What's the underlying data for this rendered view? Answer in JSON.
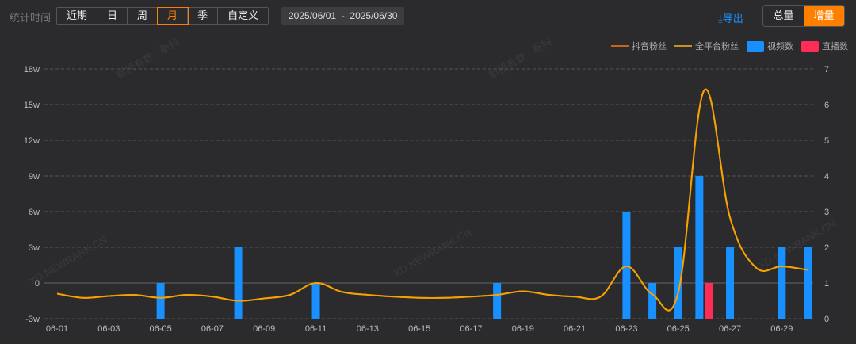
{
  "header": {
    "stat_label": "统计时间",
    "periods": [
      "近期",
      "日",
      "周",
      "月",
      "季",
      "自定义"
    ],
    "active_period": "月",
    "date_range": "2025/06/01  -  2025/06/30",
    "export_label": "导出",
    "toggle": [
      "总量",
      "增量"
    ],
    "active_toggle": "增量"
  },
  "watermarks": [
    "新榜有数 · 新抖",
    "新榜有数 · 新抖",
    "XD.NEWRANK.CN",
    "XD.NEWRANK.CN",
    "XD.NEWRANK.CN"
  ],
  "colors": {
    "douyin": "#c8641e",
    "all": "#f5a300",
    "video": "#1890ff",
    "live": "#ff2d55"
  },
  "chart_data": {
    "type": "bar+line",
    "categories": [
      "06-01",
      "06-02",
      "06-03",
      "06-04",
      "06-05",
      "06-06",
      "06-07",
      "06-08",
      "06-09",
      "06-10",
      "06-11",
      "06-12",
      "06-13",
      "06-14",
      "06-15",
      "06-16",
      "06-17",
      "06-18",
      "06-19",
      "06-20",
      "06-21",
      "06-22",
      "06-23",
      "06-24",
      "06-25",
      "06-26",
      "06-27",
      "06-28",
      "06-29",
      "06-30"
    ],
    "x_tick_labels": [
      "06-01",
      "06-03",
      "06-05",
      "06-07",
      "06-09",
      "06-11",
      "06-13",
      "06-15",
      "06-17",
      "06-19",
      "06-21",
      "06-23",
      "06-25",
      "06-27",
      "06-29"
    ],
    "left_axis": {
      "ticks": [
        "-3w",
        "0",
        "3w",
        "6w",
        "9w",
        "12w",
        "15w",
        "18w"
      ],
      "range": [
        -30000,
        180000
      ]
    },
    "right_axis": {
      "ticks": [
        "0",
        "1",
        "2",
        "3",
        "4",
        "5",
        "6",
        "7"
      ],
      "range": [
        0,
        7
      ]
    },
    "legend": [
      "抖音粉丝",
      "全平台粉丝",
      "视频数",
      "直播数"
    ],
    "series": [
      {
        "name": "抖音粉丝",
        "axis": "left",
        "type": "line",
        "values": [
          -9000,
          -12500,
          -11000,
          -10000,
          -12500,
          -10000,
          -11500,
          -15000,
          -13000,
          -10000,
          0,
          -7500,
          -10000,
          -11500,
          -12500,
          -12500,
          -11500,
          -10000,
          -7000,
          -10000,
          -11500,
          -11500,
          14000,
          -9500,
          -8000,
          162000,
          55000,
          13000,
          14000,
          11000
        ]
      },
      {
        "name": "全平台粉丝",
        "axis": "left",
        "type": "line",
        "values": [
          -9000,
          -12500,
          -11000,
          -10000,
          -12500,
          -10000,
          -11500,
          -15000,
          -13000,
          -10000,
          0,
          -7500,
          -10000,
          -11500,
          -12500,
          -12500,
          -11500,
          -10000,
          -7000,
          -10000,
          -11500,
          -11500,
          14000,
          -9500,
          -8000,
          162000,
          55000,
          13000,
          14000,
          11000
        ]
      },
      {
        "name": "视频数",
        "axis": "right",
        "type": "bar",
        "values": [
          0,
          0,
          0,
          0,
          1,
          0,
          0,
          2,
          0,
          0,
          1,
          0,
          0,
          0,
          0,
          0,
          0,
          1,
          0,
          0,
          0,
          0,
          3,
          1,
          2,
          4,
          2,
          0,
          2,
          2
        ]
      },
      {
        "name": "直播数",
        "axis": "right",
        "type": "bar",
        "values": [
          0,
          0,
          0,
          0,
          0,
          0,
          0,
          0,
          0,
          0,
          0,
          0,
          0,
          0,
          0,
          0,
          0,
          0,
          0,
          0,
          0,
          0,
          0,
          0,
          0,
          1,
          0,
          0,
          0,
          0
        ]
      }
    ]
  }
}
